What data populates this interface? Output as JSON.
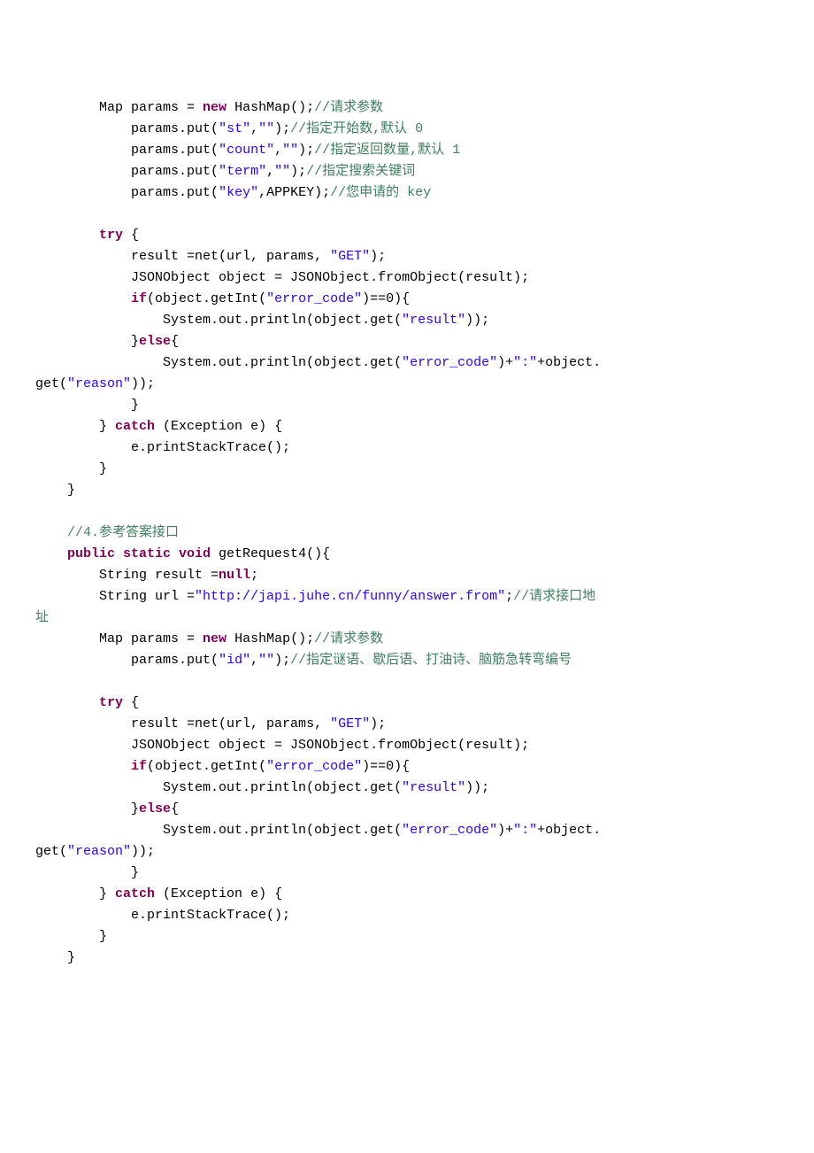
{
  "code_lang": "java",
  "block1": {
    "indent": "        ",
    "new_map": "Map params = ",
    "kw_new": "new",
    "hashmap": " HashMap();",
    "cmt_new": "//请求参数",
    "put_indent": "            ",
    "put_pre": "params.put(",
    "p1_k": "\"st\"",
    "p1_v": "\"\"",
    "p1_c": "//指定开始数,默认 0",
    "p2_k": "\"count\"",
    "p2_v": "\"\"",
    "p2_c": "//指定返回数量,默认 1",
    "p3_k": "\"term\"",
    "p3_v": "\"\"",
    "p3_c": "//指定搜索关键词",
    "p4_k": "\"key\"",
    "p4_v": "APPKEY",
    "p4_c": "//您申请的 key",
    "kw_try": "try",
    "try_open": " {",
    "inner_indent": "            ",
    "res_line": "result =net(url, params, ",
    "res_method": "\"GET\"",
    "res_close": ");",
    "json_line": "JSONObject object = JSONObject.fromObject(result);",
    "kw_if": "if",
    "if_cond_pre": "(object.getInt(",
    "if_err": "\"error_code\"",
    "if_eq": ")==0){",
    "if_body_indent": "                ",
    "if_body": "System.out.println(object.get(",
    "if_result": "\"result\"",
    "if_close": "));",
    "kw_else": "else",
    "else_line_pre": "}",
    "else_brace": "{",
    "else_body_indent": "                ",
    "else_body_pre": "System.out.println(object.get(",
    "else_err": "\"error_code\"",
    "else_mid": ")+",
    "else_colon": "\":\"",
    "else_after": "+object.",
    "wrap_get": "get(",
    "wrap_reason": "\"reason\"",
    "wrap_close": "));",
    "close_brace": "            }",
    "catch_close_try": "        } ",
    "kw_catch": "catch",
    "catch_sig": " (Exception e) {",
    "catch_body": "            e.printStackTrace();",
    "catch_close": "        }",
    "method_close": "    }"
  },
  "block2": {
    "indent": "    ",
    "cmt_header": "//4.参考答案接口",
    "method_sig_pre": "public static void",
    "method_name": " getRequest4(){",
    "body_indent": "        ",
    "res_decl_pre": "String result =",
    "kw_null": "null",
    "res_decl_end": ";",
    "url_decl_pre": "String url =",
    "url_str": "\"http://japi.juhe.cn/funny/answer.from\"",
    "url_end": ";",
    "url_cmt": "//请求接口地",
    "url_cmt_wrap": "址",
    "new_map": "Map params = ",
    "kw_new": "new",
    "hashmap": " HashMap();",
    "cmt_new": "//请求参数",
    "put_indent": "            ",
    "put_pre": "params.put(",
    "p1_k": "\"id\"",
    "p1_v": "\"\"",
    "p1_c": "//指定谜语、歇后语、打油诗、脑筋急转弯编号",
    "kw_try": "try",
    "try_open": " {",
    "inner_indent": "            ",
    "res_line": "result =net(url, params, ",
    "res_method": "\"GET\"",
    "res_close": ");",
    "json_line": "JSONObject object = JSONObject.fromObject(result);",
    "kw_if": "if",
    "if_cond_pre": "(object.getInt(",
    "if_err": "\"error_code\"",
    "if_eq": ")==0){",
    "if_body_indent": "                ",
    "if_body": "System.out.println(object.get(",
    "if_result": "\"result\"",
    "if_close": "));",
    "kw_else": "else",
    "else_line_pre": "}",
    "else_brace": "{",
    "else_body_indent": "                ",
    "else_body_pre": "System.out.println(object.get(",
    "else_err": "\"error_code\"",
    "else_mid": ")+",
    "else_colon": "\":\"",
    "else_after": "+object.",
    "wrap_get": "get(",
    "wrap_reason": "\"reason\"",
    "wrap_close": "));",
    "close_brace": "            }",
    "catch_close_try": "        } ",
    "kw_catch": "catch",
    "catch_sig": " (Exception e) {",
    "catch_body": "            e.printStackTrace();",
    "catch_close": "        }",
    "method_close": "    }"
  }
}
